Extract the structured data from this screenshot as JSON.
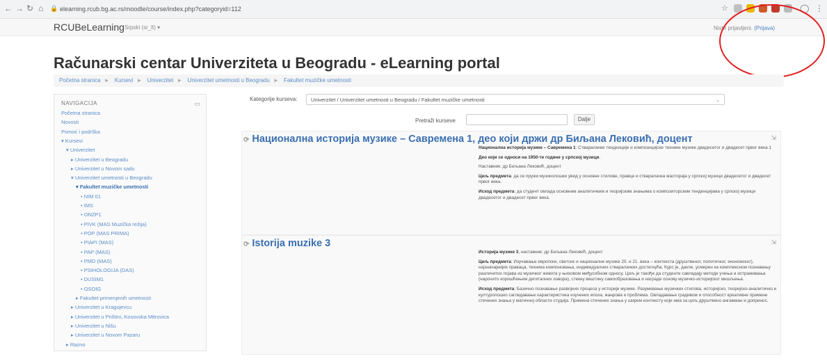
{
  "browser": {
    "url": "elearning.rcub.bg.ac.rs/moodle/course/index.php?categoryid=112",
    "colors": {
      "ext1": "#c0c0c0",
      "ext2": "#e8b800",
      "ext3": "#d05a2a",
      "ext4": "#c0392b",
      "ext5": "#bbbbbb"
    }
  },
  "topbar": {
    "brand": "RCUBeLearning",
    "lang": "Srpski (sr_lt) ▾",
    "login_text": "Niste prijavljeni.",
    "login_link": "(Prijava)"
  },
  "page": {
    "heading": "Računarski centar Univerziteta u Beogradu - eLearning portal",
    "breadcrumbs": [
      "Početna stranica",
      "Kursevi",
      "Univerzitet",
      "Univerzitet umetnosti u Beogradu",
      "Fakultet muzičke umetnosti"
    ]
  },
  "nav": {
    "title": "NAVIGACIJA",
    "toggle": "▭",
    "items": [
      {
        "label": "Početna stranica",
        "level": 0
      },
      {
        "label": "Novosti",
        "level": 0
      },
      {
        "label": "Pomoć i podrška",
        "level": 0
      },
      {
        "label": "▾ Kursevi",
        "level": 0
      },
      {
        "label": "▾ Univerzitet",
        "level": 1
      },
      {
        "label": "▸ Univerzitet u Beogradu",
        "level": 2
      },
      {
        "label": "▸ Univerzitet u Novom sadu",
        "level": 2
      },
      {
        "label": "▾ Univerzitet umetnosti u Beogradu",
        "level": 2
      },
      {
        "label": "▾ Fakultet muzičke umetnosti",
        "level": 3,
        "bold": true
      },
      {
        "label": "• NIM 01",
        "level": 4
      },
      {
        "label": "• IMS",
        "level": 4
      },
      {
        "label": "• ONZP1",
        "level": 4
      },
      {
        "label": "• PIVK (MAS Muzička režija)",
        "level": 4
      },
      {
        "label": "• POP (MAS PRIMA)",
        "level": 4
      },
      {
        "label": "• PIAPI (MAS)",
        "level": 4
      },
      {
        "label": "• PAP (MAS)",
        "level": 4
      },
      {
        "label": "• PMD (MAS)",
        "level": 4
      },
      {
        "label": "• PSIHOLOGIJA (DAS)",
        "level": 4
      },
      {
        "label": "• DUSIM1",
        "level": 4
      },
      {
        "label": "• OSOIG",
        "level": 4
      },
      {
        "label": "▸ Fakultet primenjenih umetnosti",
        "level": 3
      },
      {
        "label": "▸ Univerzitet u Kragujevcu",
        "level": 2
      },
      {
        "label": "▸ Univerzitet u Prištini, Kosovska Mitrovica",
        "level": 2
      },
      {
        "label": "▸ Univerzitet u Nišu",
        "level": 2
      },
      {
        "label": "▸ Univerzitet u Novom Pazaru",
        "level": 2
      },
      {
        "label": "▸ Razno",
        "level": 1
      }
    ]
  },
  "filter": {
    "label": "Kategorije kurseva:",
    "selected": "Univerzitet / Univerzitet umetnosti u Beogradu / Fakultet muzičke umetnosti",
    "search_label": "Pretraži kurseve",
    "search_placeholder": "",
    "search_button": "Dalje"
  },
  "courses": [
    {
      "title": "Национална историја музике – Савремена 1, део који држи др Биљана Лековић, доцент",
      "summary": [
        {
          "b": "Национална историја музике – Савремена 1",
          "t": ": Стваралачке тенденције и композицијске технике музике двадесетог и двадесет првог века 1"
        },
        {
          "b": "Део који се односи на 1950-те године у српској музици",
          "t": "."
        },
        {
          "b": "",
          "t": "Наставник: др Биљана Лековић, доцент"
        },
        {
          "b": "Циљ предмета",
          "t": ": да се пружи музиколошки увид у основне стилове, правце и стваралачка мастораја у српској музици двадесетог и двадесет првог века."
        },
        {
          "b": "Исход предмета",
          "t": ": да студент овлада основним аналитичким и теоријским знањима о композиторским тенденцијама у српској музици двадесетог и двадесет првог века."
        }
      ]
    },
    {
      "title": "Istorija muzike 3",
      "summary": [
        {
          "b": "Историја музике 3",
          "t": ", наставник: др Биљана Лековић, доцент"
        },
        {
          "b": "Циљ предмета",
          "t": ": Изучавање европске, светске и националне музике 20. и 21. века – контекста (друштвеног, политичког, економског), најзначајнијих праваца, техника компоновања, индивидуалних стваралачких достигнућа. Курс је, дакле, усмерен ка комплексном познавању различитих појава из музичког живота у њиховом међусобном односу. Циљ је такође да студенти савладају методе учења и истраживања (нарочито коришћењем дигиталних извора), стекну вештину самообразовања и награде основу музичко-историјског мишљења."
        },
        {
          "b": "Исход предмета",
          "t": ": Базично познавање развојних процеса у историји музике. Разумевање музичких стилова, историјско, теоријско-аналитичко и културолошко сагледавање карактеристика изучених епоха, жанрова и проблема. Овладавање градивом и способност креативне примене стечених знања у матичној области студија. Примена стечених знања у ширем контексту који има за циљ друштвено ангажман и допринос."
        }
      ]
    }
  ]
}
